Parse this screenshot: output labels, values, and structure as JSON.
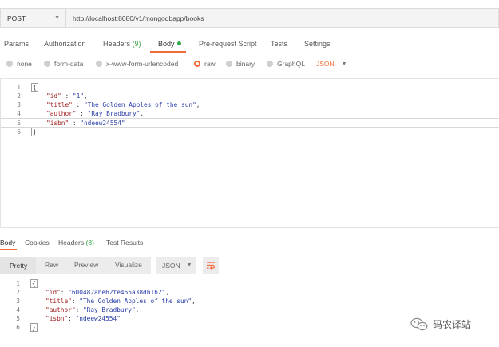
{
  "request": {
    "method": "POST",
    "url": "http://localhost:8080/v1/mongodbapp/books"
  },
  "request_tabs": {
    "params": "Params",
    "authorization": "Authorization",
    "headers": "Headers",
    "headers_count": "(9)",
    "body": "Body",
    "prerequest": "Pre-request Script",
    "tests": "Tests",
    "settings": "Settings"
  },
  "body_types": {
    "none": "none",
    "form_data": "form-data",
    "urlencoded": "x-www-form-urlencoded",
    "raw": "raw",
    "binary": "binary",
    "graphql": "GraphQL",
    "json": "JSON"
  },
  "request_body": {
    "line_numbers": [
      "1",
      "2",
      "3",
      "4",
      "5",
      "6"
    ],
    "open_brace": "{",
    "close_brace": "}",
    "fields": [
      {
        "key": "\"id\"",
        "sep": " : ",
        "value": "\"1\"",
        "tail": ","
      },
      {
        "key": "\"title\"",
        "sep": " : ",
        "value": "\"The Golden Apples of the sun\"",
        "tail": ","
      },
      {
        "key": "\"author\"",
        "sep": " : ",
        "value": "\"Ray Bradbury\"",
        "tail": ","
      },
      {
        "key": "\"isbn\"",
        "sep": " : ",
        "value": "\"ndeew24554\"",
        "tail": ""
      }
    ]
  },
  "response_tabs": {
    "body": "Body",
    "cookies": "Cookies",
    "headers": "Headers",
    "headers_count": "(8)",
    "test_results": "Test Results"
  },
  "response_toolbar": {
    "pretty": "Pretty",
    "raw": "Raw",
    "preview": "Preview",
    "visualize": "Visualize",
    "format": "JSON"
  },
  "response_body": {
    "line_numbers": [
      "1",
      "2",
      "3",
      "4",
      "5",
      "6"
    ],
    "open_brace": "{",
    "close_brace": "}",
    "fields": [
      {
        "key": "\"id\"",
        "sep": ": ",
        "value": "\"600482abe62fe455a38db1b2\"",
        "tail": ","
      },
      {
        "key": "\"title\"",
        "sep": ": ",
        "value": "\"The Golden Apples of the sun\"",
        "tail": ","
      },
      {
        "key": "\"author\"",
        "sep": ": ",
        "value": "\"Ray Bradbury\"",
        "tail": ","
      },
      {
        "key": "\"isbn\"",
        "sep": ": ",
        "value": "\"ndeew24554\"",
        "tail": ""
      }
    ]
  },
  "watermark": {
    "text": "码农译站",
    "icon": "wechat-icon"
  },
  "colors": {
    "accent": "#f26b3a",
    "success": "#2fab4b",
    "json_key": "#a11e1e",
    "json_string": "#2b3fa8"
  }
}
